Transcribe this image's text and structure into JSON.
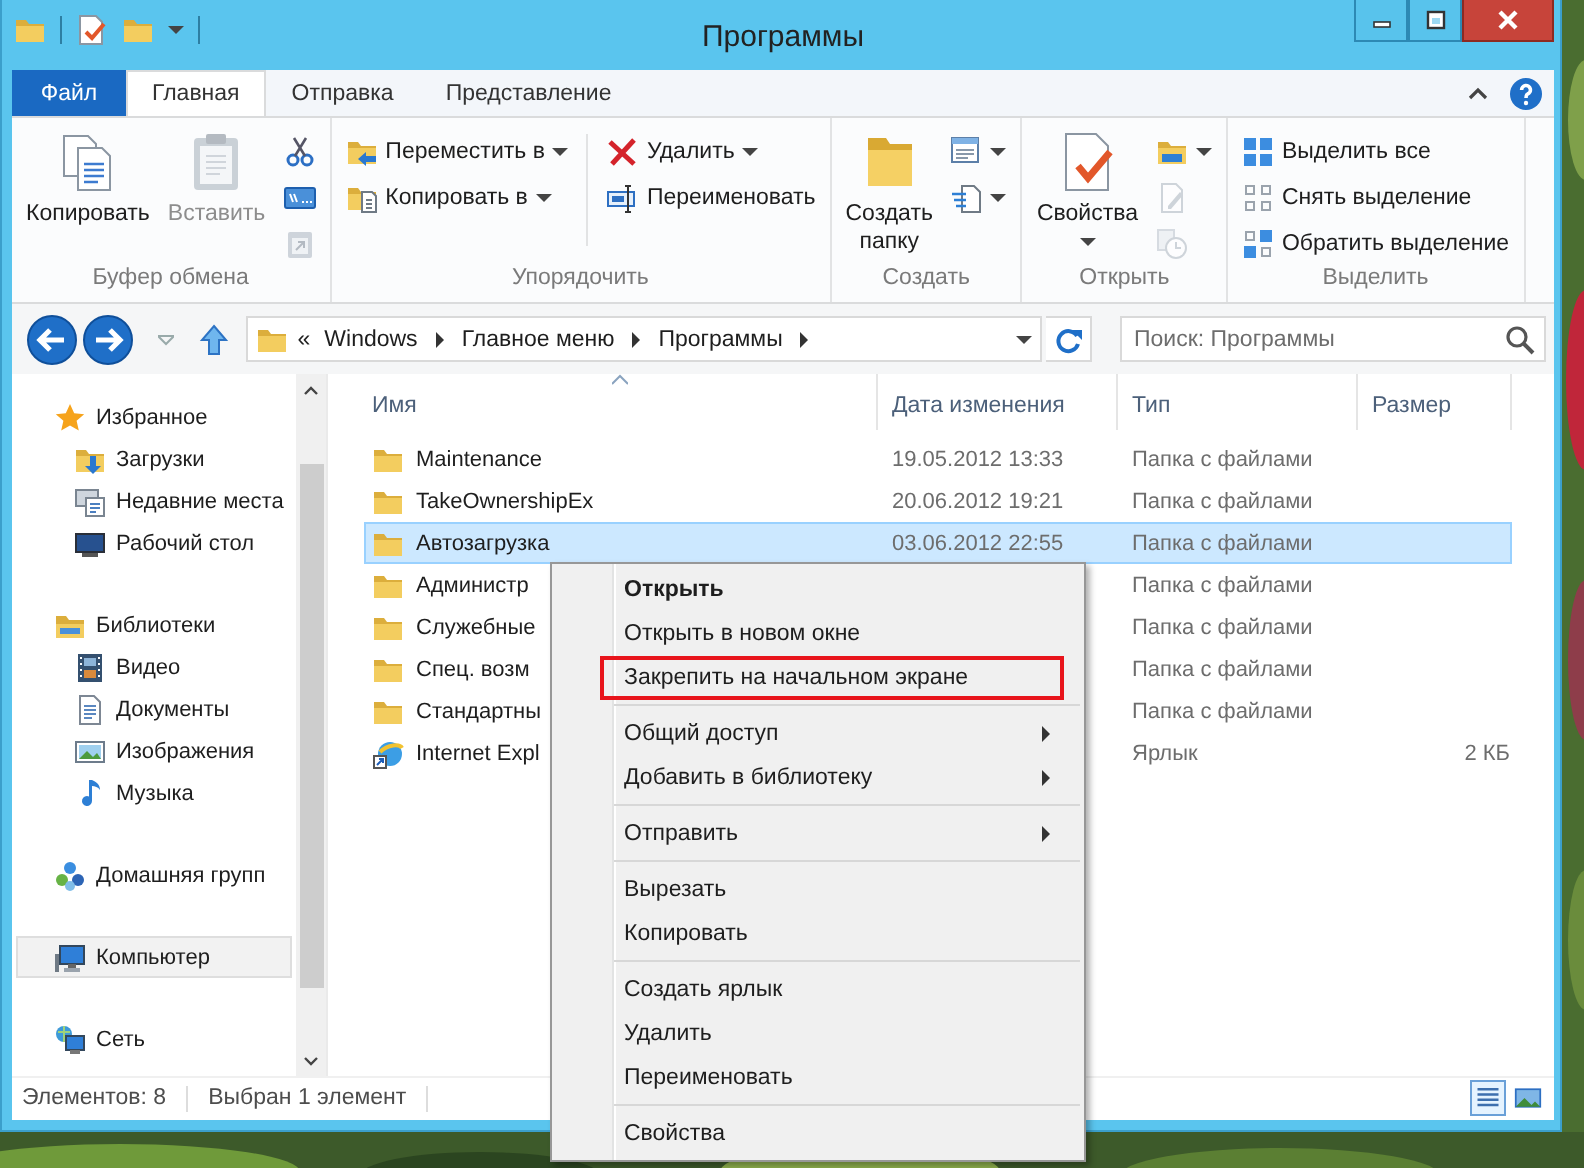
{
  "window": {
    "title": "Программы"
  },
  "tabs": [
    {
      "label": "Файл",
      "kind": "file",
      "selected": false
    },
    {
      "label": "Главная",
      "kind": "tab",
      "selected": true
    },
    {
      "label": "Отправка",
      "kind": "tab",
      "selected": false
    },
    {
      "label": "Представление",
      "kind": "tab",
      "selected": false
    }
  ],
  "ribbon": {
    "groups": [
      {
        "label": "Буфер обмена",
        "buttons": [
          {
            "kind": "large",
            "label": "Копировать",
            "caret": false,
            "disabled": false
          },
          {
            "kind": "large",
            "label": "Вставить",
            "caret": false,
            "disabled": true
          },
          {
            "kind": "icon",
            "caret": false,
            "disabled": false
          },
          {
            "kind": "icon",
            "caret": false,
            "disabled": false
          },
          {
            "kind": "icon",
            "caret": false,
            "disabled": true
          }
        ]
      },
      {
        "label": "Упорядочить",
        "buttons": [
          {
            "kind": "small",
            "label": "Переместить в",
            "caret": true,
            "disabled": false
          },
          {
            "kind": "small",
            "label": "Копировать в",
            "caret": true,
            "disabled": false
          },
          {
            "kind": "divider"
          },
          {
            "kind": "small",
            "label": "Удалить",
            "caret": true,
            "disabled": false
          },
          {
            "kind": "small",
            "label": "Переименовать",
            "caret": false,
            "disabled": false
          }
        ]
      },
      {
        "label": "Создать",
        "buttons": [
          {
            "kind": "large",
            "label": "Создать папку",
            "caret": false,
            "disabled": false
          },
          {
            "kind": "icon",
            "caret": true,
            "disabled": false
          },
          {
            "kind": "icon",
            "caret": true,
            "disabled": false
          }
        ]
      },
      {
        "label": "Открыть",
        "buttons": [
          {
            "kind": "large",
            "label": "Свойства",
            "caret": true,
            "disabled": false
          },
          {
            "kind": "icon",
            "caret": true,
            "disabled": false
          },
          {
            "kind": "icon",
            "caret": false,
            "disabled": true
          },
          {
            "kind": "icon",
            "caret": false,
            "disabled": true
          }
        ]
      },
      {
        "label": "Выделить",
        "buttons": [
          {
            "kind": "small",
            "label": "Выделить все",
            "caret": false,
            "disabled": false
          },
          {
            "kind": "small",
            "label": "Снять выделение",
            "caret": false,
            "disabled": false
          },
          {
            "kind": "small",
            "label": "Обратить выделение",
            "caret": false,
            "disabled": false
          }
        ]
      }
    ]
  },
  "address": {
    "overflow": "«",
    "crumbs": [
      "Windows",
      "Главное меню",
      "Программы"
    ]
  },
  "search": {
    "placeholder": "Поиск: Программы"
  },
  "navigation": [
    {
      "label": "Избранное",
      "kind": "favorites",
      "selected": false,
      "children": [
        {
          "label": "Загрузки",
          "kind": "downloads",
          "selected": false
        },
        {
          "label": "Недавние места",
          "kind": "recent",
          "selected": false
        },
        {
          "label": "Рабочий стол",
          "kind": "desktop",
          "selected": false
        }
      ]
    },
    {
      "label": "Библиотеки",
      "kind": "library",
      "selected": false,
      "children": [
        {
          "label": "Видео",
          "kind": "video",
          "selected": false
        },
        {
          "label": "Документы",
          "kind": "documents",
          "selected": false
        },
        {
          "label": "Изображения",
          "kind": "images",
          "selected": false
        },
        {
          "label": "Музыка",
          "kind": "music",
          "selected": false
        }
      ]
    },
    {
      "label": "Домашняя групп",
      "kind": "homegroup",
      "selected": false
    },
    {
      "label": "Компьютер",
      "kind": "computer",
      "selected": true
    },
    {
      "label": "Сеть",
      "kind": "network",
      "selected": false
    }
  ],
  "columns": [
    {
      "label": "Имя",
      "sorted": true
    },
    {
      "label": "Дата изменения",
      "sorted": false
    },
    {
      "label": "Тип",
      "sorted": false
    },
    {
      "label": "Размер",
      "sorted": false
    }
  ],
  "rows": [
    {
      "kind": "folder",
      "name": "Maintenance",
      "date": "19.05.2012 13:33",
      "type": "Папка с файлами",
      "selected": false
    },
    {
      "kind": "folder",
      "name": "TakeOwnershipEx",
      "date": "20.06.2012 19:21",
      "type": "Папка с файлами",
      "selected": false
    },
    {
      "kind": "folder",
      "name": "Автозагрузка",
      "date": "03.06.2012 22:55",
      "type": "Папка с файлами",
      "selected": true
    },
    {
      "kind": "folder",
      "name": "Администр",
      "type": "Папка с файлами",
      "selected": false
    },
    {
      "kind": "folder",
      "name": "Служебные",
      "type": "Папка с файлами",
      "selected": false
    },
    {
      "kind": "folder",
      "name": "Спец. возм",
      "type": "Папка с файлами",
      "selected": false
    },
    {
      "kind": "folder",
      "name": "Стандартны",
      "type": "Папка с файлами",
      "selected": false
    },
    {
      "kind": "shortcut",
      "name": "Internet Expl",
      "type": "Ярлык",
      "size": "2 КБ",
      "selected": false
    }
  ],
  "status_bar": {
    "count": "Элементов: 8",
    "selection": "Выбран 1 элемент",
    "views": [
      {
        "selected": true
      },
      {
        "selected": false
      }
    ]
  },
  "context_menu": {
    "items": [
      {
        "kind": "item",
        "label": "Открыть",
        "default": true,
        "submenu": false,
        "outlined": false
      },
      {
        "kind": "item",
        "label": "Открыть в новом окне",
        "default": false,
        "submenu": false,
        "outlined": false
      },
      {
        "kind": "item",
        "label": "Закрепить на начальном экране",
        "default": false,
        "submenu": false,
        "outlined": true
      },
      {
        "kind": "separator"
      },
      {
        "kind": "item",
        "label": "Общий доступ",
        "default": false,
        "submenu": true,
        "outlined": false
      },
      {
        "kind": "item",
        "label": "Добавить в библиотеку",
        "default": false,
        "submenu": true,
        "outlined": false
      },
      {
        "kind": "separator"
      },
      {
        "kind": "item",
        "label": "Отправить",
        "default": false,
        "submenu": true,
        "outlined": false
      },
      {
        "kind": "separator"
      },
      {
        "kind": "item",
        "label": "Вырезать",
        "default": false,
        "submenu": false,
        "outlined": false
      },
      {
        "kind": "item",
        "label": "Копировать",
        "default": false,
        "submenu": false,
        "outlined": false
      },
      {
        "kind": "separator"
      },
      {
        "kind": "item",
        "label": "Создать ярлык",
        "default": false,
        "submenu": false,
        "outlined": false
      },
      {
        "kind": "item",
        "label": "Удалить",
        "default": false,
        "submenu": false,
        "outlined": false
      },
      {
        "kind": "item",
        "label": "Переименовать",
        "default": false,
        "submenu": false,
        "outlined": false
      },
      {
        "kind": "separator"
      },
      {
        "kind": "item",
        "label": "Свойства",
        "default": false,
        "submenu": false,
        "outlined": false
      }
    ]
  }
}
